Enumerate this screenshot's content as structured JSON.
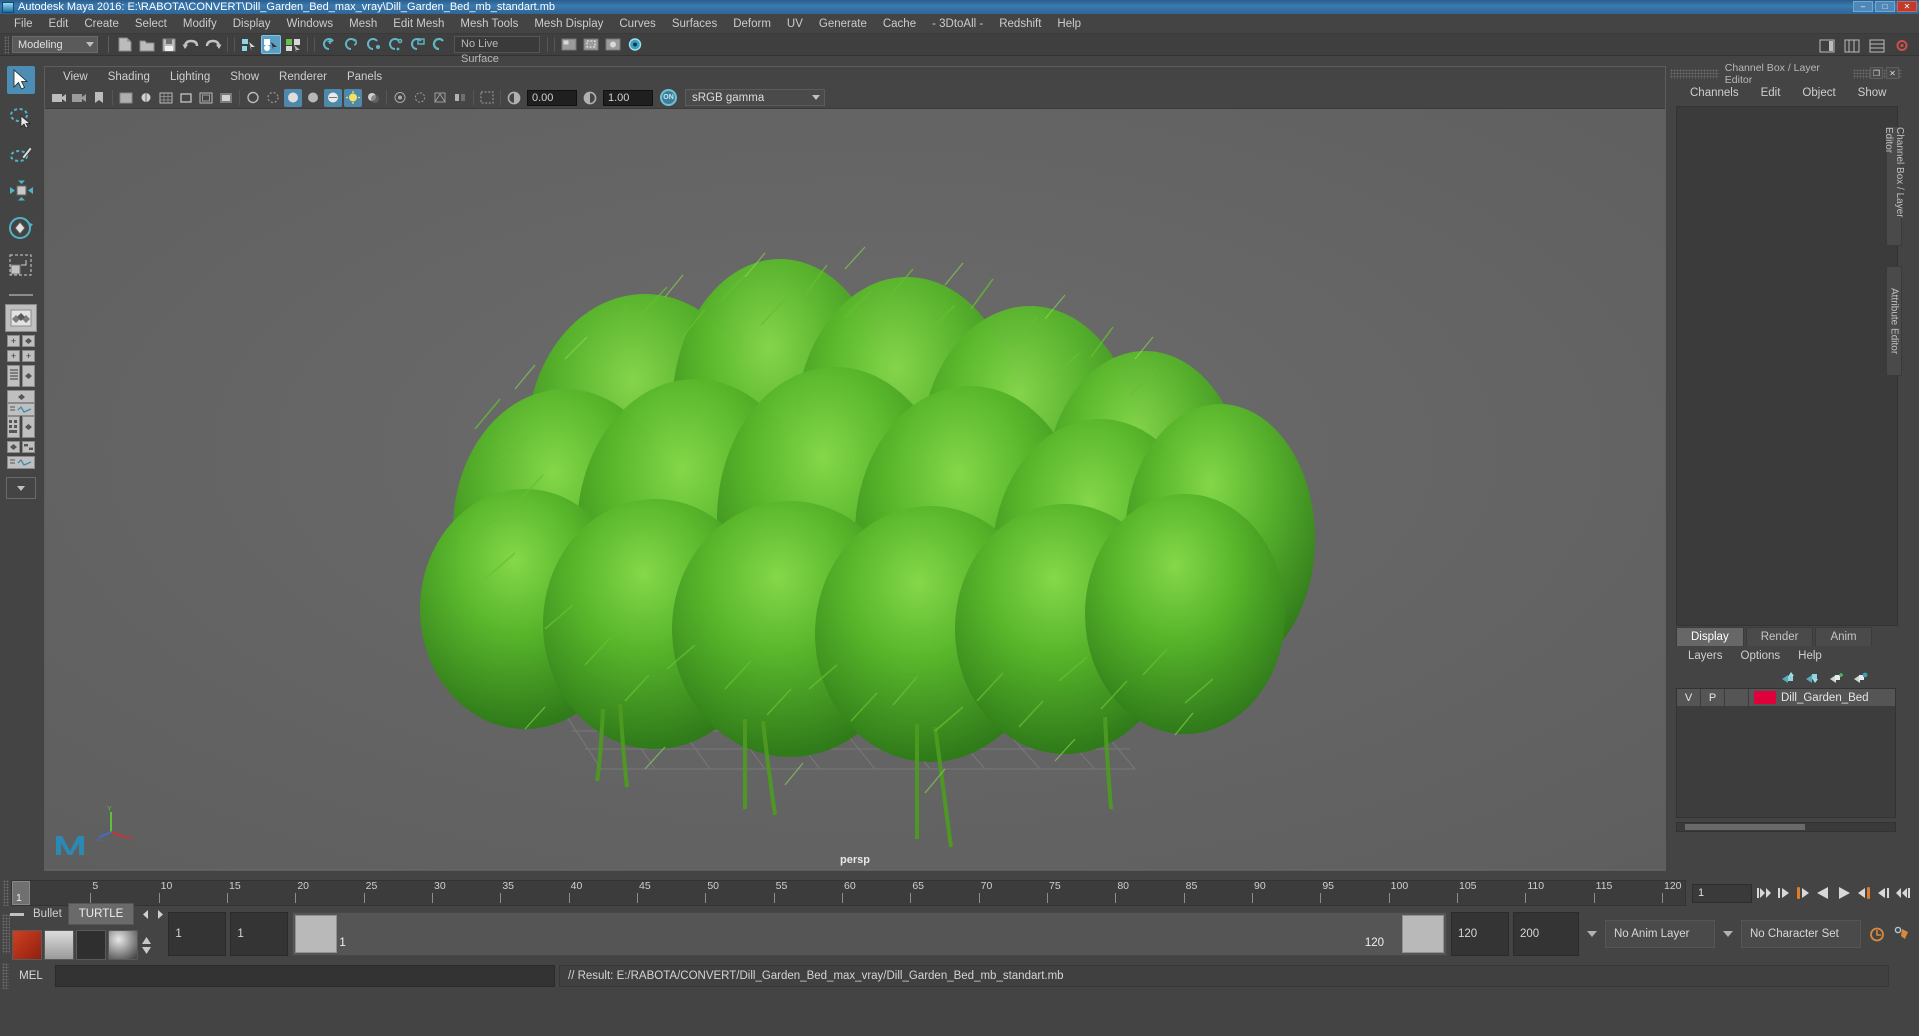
{
  "window": {
    "title": "Autodesk Maya 2016: E:\\RABOTA\\CONVERT\\Dill_Garden_Bed_max_vray\\Dill_Garden_Bed_mb_standart.mb",
    "app_icon": "maya-icon",
    "minimize": "–",
    "maximize": "□",
    "close": "✕"
  },
  "menubar": {
    "items": [
      "File",
      "Edit",
      "Create",
      "Select",
      "Modify",
      "Display",
      "Windows",
      "Mesh",
      "Edit Mesh",
      "Mesh Tools",
      "Mesh Display",
      "Curves",
      "Surfaces",
      "Deform",
      "UV",
      "Generate",
      "Cache",
      "- 3DtoAll -",
      "Redshift",
      "Help"
    ]
  },
  "statusbar": {
    "menuset": "Modeling",
    "live_surface": "No Live Surface",
    "icons": [
      "new-scene-icon",
      "open-scene-icon",
      "save-scene-icon",
      "undo-icon",
      "redo-icon",
      "select-by-hierarchy-icon",
      "select-by-object-icon",
      "select-by-component-icon",
      "snap-to-grid-icon",
      "snap-to-curve-icon",
      "snap-to-point-icon",
      "snap-to-projected-center-icon",
      "snap-to-view-plane-icon",
      "magnet-icon",
      "render-view-icon",
      "render-region-icon",
      "ipr-render-icon",
      "render-settings-icon"
    ],
    "right_icons": [
      "sidebar-toggle-icon",
      "channel-box-toggle-icon",
      "attribute-editor-toggle-icon",
      "tool-settings-toggle-icon"
    ]
  },
  "toolbox": {
    "tools": [
      {
        "name": "select-tool",
        "selected": true
      },
      {
        "name": "lasso-select-tool",
        "selected": false
      },
      {
        "name": "paint-select-tool",
        "selected": false
      },
      {
        "name": "move-tool",
        "selected": false
      },
      {
        "name": "rotate-tool",
        "selected": false
      },
      {
        "name": "scale-tool",
        "selected": false
      }
    ],
    "quick_layouts": [
      "single-perspective-layout",
      "four-view-layout",
      "two-pane-side-layout",
      "outliner-persp-layout",
      "persp-graph-layout",
      "hypershade-persp-layout",
      "outliner-graph-layout",
      "layout-menu-dropdown"
    ]
  },
  "panel": {
    "menus": [
      "View",
      "Shading",
      "Lighting",
      "Show",
      "Renderer",
      "Panels"
    ],
    "toolbar": {
      "exposure": "0.00",
      "gamma": "1.00",
      "color_management_toggle": "ON",
      "view_transform": "sRGB gamma"
    },
    "camera_label": "persp",
    "gizmo_axes": [
      "Y",
      "X",
      "Z"
    ]
  },
  "right_panel": {
    "header_title": "Channel Box / Layer Editor",
    "window_buttons": [
      "undock-icon",
      "close-icon"
    ],
    "tabs": [
      "Channels",
      "Edit",
      "Object",
      "Show"
    ],
    "side_tabs": [
      "Channel Box / Layer Editor",
      "Attribute Editor"
    ],
    "layer_editor": {
      "tabs": [
        {
          "label": "Display",
          "active": true
        },
        {
          "label": "Render",
          "active": false
        },
        {
          "label": "Anim",
          "active": false
        }
      ],
      "menus": [
        "Layers",
        "Options",
        "Help"
      ],
      "toolbar_icons": [
        "move-layer-up-icon",
        "move-layer-down-icon",
        "new-layer-icon",
        "new-layer-from-selected-icon"
      ],
      "columns": [
        "V",
        "P"
      ],
      "layers": [
        {
          "visible": "V",
          "playback": "P",
          "color": "#e0003c",
          "name": "Dill_Garden_Bed"
        }
      ]
    }
  },
  "timeline": {
    "start": 1,
    "end": 120,
    "current_frame": "1",
    "tick_labels": [
      "5",
      "10",
      "15",
      "20",
      "25",
      "30",
      "35",
      "40",
      "45",
      "50",
      "55",
      "60",
      "65",
      "70",
      "75",
      "80",
      "85",
      "90",
      "95",
      "100",
      "105",
      "110",
      "115",
      "120"
    ],
    "current_frame_field": "1",
    "transport_icons": [
      "go-to-start-icon",
      "step-back-keyframe-icon",
      "step-back-frame-icon",
      "play-backwards-icon",
      "play-forwards-icon",
      "step-forward-frame-icon",
      "step-forward-keyframe-icon",
      "go-to-end-icon"
    ]
  },
  "range_bar": {
    "shelf_tabs": [
      "Bullet",
      "TURTLE"
    ],
    "shelf_nav": [
      "prev-shelf-arrow",
      "next-shelf-arrow"
    ],
    "anim_start": "1",
    "anim_end_field": "1",
    "range_start": "1",
    "range_end": "120",
    "playback_end": "120",
    "anim_end": "200",
    "anim_layer": "No Anim Layer",
    "character_set": "No Character Set",
    "right_icons": [
      "animation-preferences-icon",
      "playback-settings-icon"
    ]
  },
  "command_line": {
    "language": "MEL",
    "input_value": "",
    "result": "// Result: E:/RABOTA/CONVERT/Dill_Garden_Bed_max_vray/Dill_Garden_Bed_mb_standart.mb"
  },
  "colors": {
    "accent_blue": "#4b8db5",
    "layer_red": "#e0003c",
    "viewport_bg": "#656565",
    "panel_bg": "#444444",
    "plant_green": "#4aa52a"
  }
}
